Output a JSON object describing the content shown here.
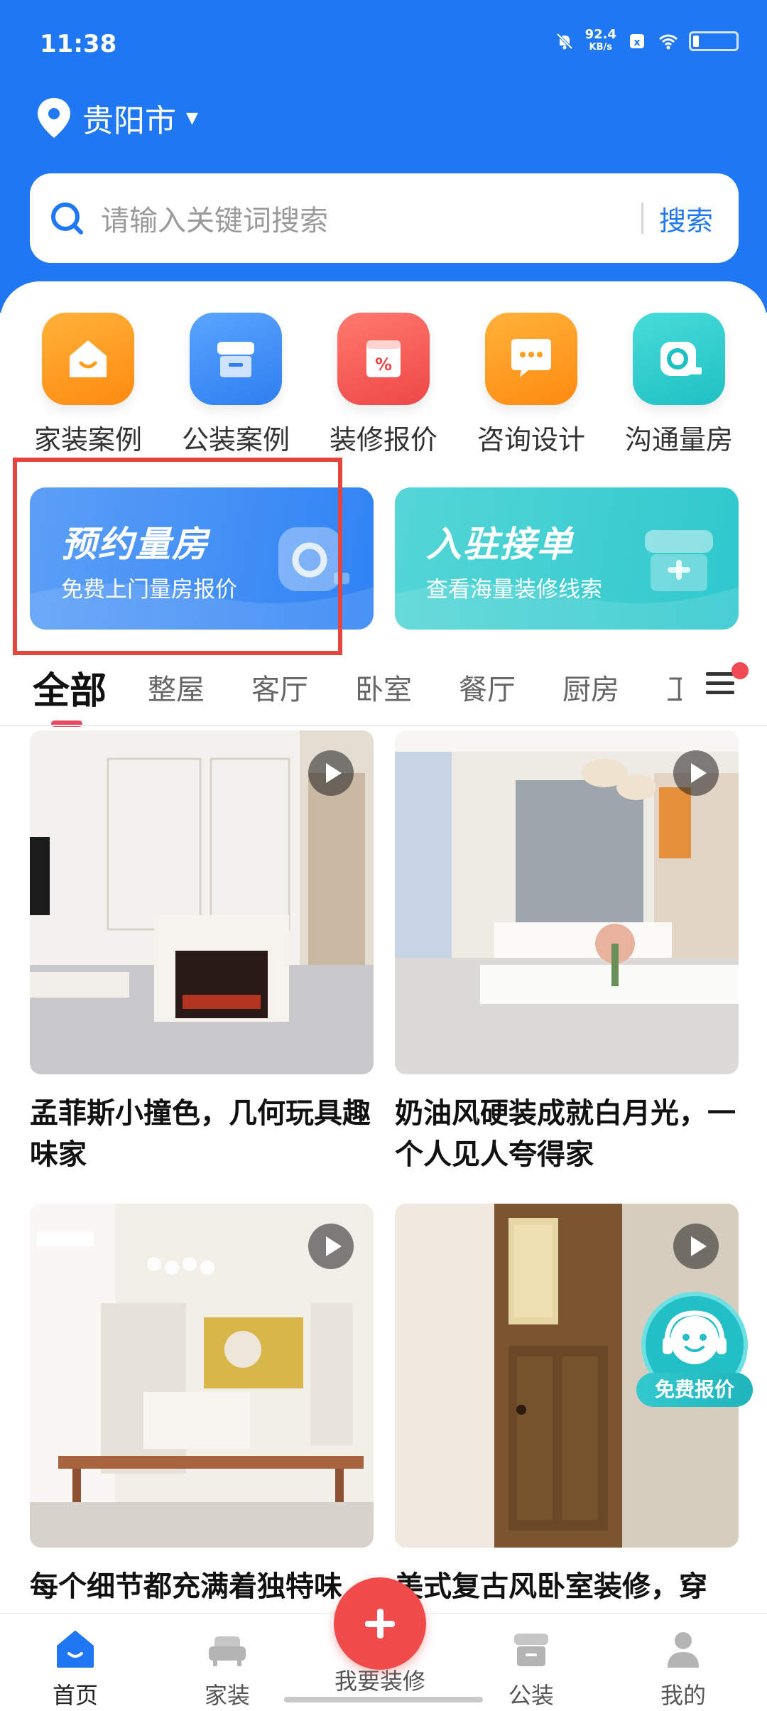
{
  "status_bar": {
    "time": "11:38",
    "speed": "92.4",
    "speed_unit": "KB/s"
  },
  "location": {
    "city": "贵阳市"
  },
  "search": {
    "placeholder": "请输入关键词搜索",
    "button": "搜索"
  },
  "shortcuts": [
    {
      "label": "家装案例",
      "icon": "house-smile-icon",
      "color": "#ff9d1c"
    },
    {
      "label": "公装案例",
      "icon": "storefront-icon",
      "color": "#3d8df5"
    },
    {
      "label": "装修报价",
      "icon": "calculator-icon",
      "color": "#f25a55"
    },
    {
      "label": "咨询设计",
      "icon": "chat-bubble-icon",
      "color": "#ff9d1c"
    },
    {
      "label": "沟通量房",
      "icon": "tape-measure-icon",
      "color": "#2fc9c9"
    }
  ],
  "banners": {
    "left": {
      "title": "预约量房",
      "subtitle": "免费上门量房报价"
    },
    "right": {
      "title": "入驻接单",
      "subtitle": "查看海量装修线索"
    }
  },
  "tabs": [
    "全部",
    "整屋",
    "客厅",
    "卧室",
    "餐厅",
    "厨房",
    "卫"
  ],
  "cards": [
    {
      "title": "孟菲斯小撞色，几何玩具趣味家"
    },
    {
      "title": "奶油风硬装成就白月光，一个人见人夸得家"
    },
    {
      "title": "每个细节都充满着独特味"
    },
    {
      "title": "美式复古风卧室装修，穿"
    }
  ],
  "float_service": {
    "label": "免费报价"
  },
  "bottom_nav": {
    "items": [
      {
        "label": "首页",
        "icon": "home-icon"
      },
      {
        "label": "家装",
        "icon": "sofa-icon"
      },
      {
        "label": "我要装修",
        "icon": "plus-icon"
      },
      {
        "label": "公装",
        "icon": "storefront-icon"
      },
      {
        "label": "我的",
        "icon": "person-icon"
      }
    ]
  },
  "colors": {
    "primary": "#1f78f2",
    "accent_red": "#e94b63",
    "highlight_border": "#e5453d"
  }
}
